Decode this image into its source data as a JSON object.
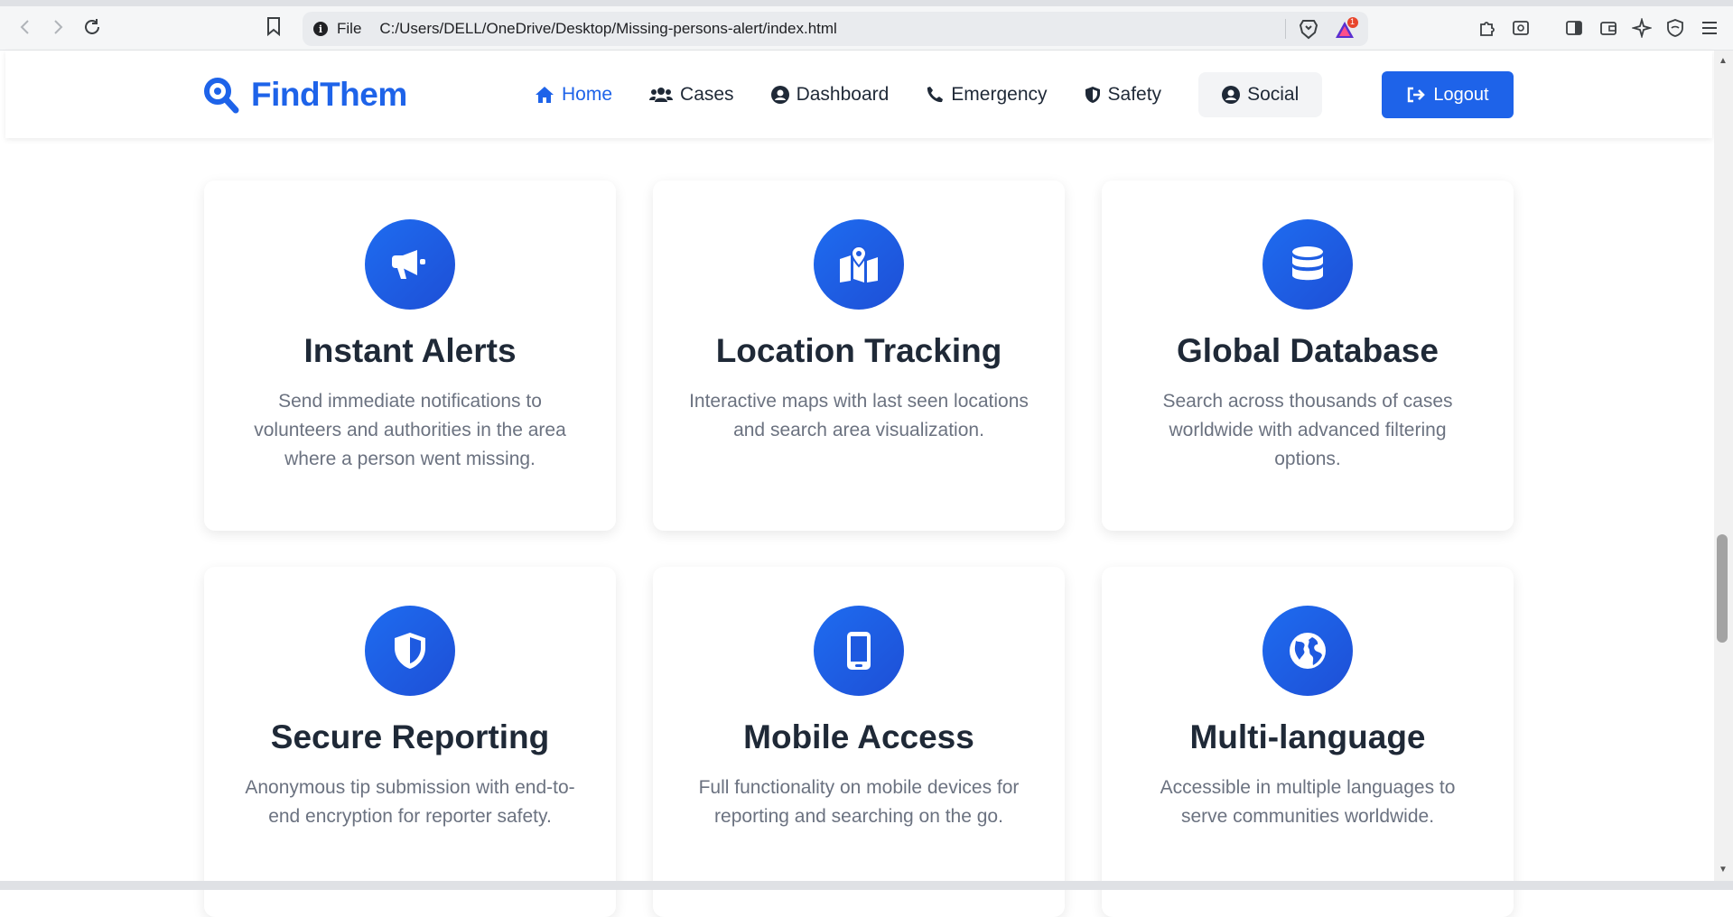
{
  "browser": {
    "url_scheme": "File",
    "url": "C:/Users/DELL/OneDrive/Desktop/Missing-persons-alert/index.html",
    "notification_count": "1"
  },
  "header": {
    "logo_text": "FindThem",
    "nav": [
      {
        "label": "Home",
        "icon": "home-icon",
        "active": true
      },
      {
        "label": "Cases",
        "icon": "users-icon"
      },
      {
        "label": "Dashboard",
        "icon": "user-circle-icon"
      },
      {
        "label": "Emergency",
        "icon": "phone-icon"
      },
      {
        "label": "Safety",
        "icon": "shield-icon"
      },
      {
        "label": "Social",
        "icon": "user-circle-icon"
      }
    ],
    "logout_label": "Logout"
  },
  "features": [
    {
      "title": "Instant Alerts",
      "description": "Send immediate notifications to volunteers and authorities in the area where a person went missing.",
      "icon": "megaphone-icon"
    },
    {
      "title": "Location Tracking",
      "description": "Interactive maps with last seen locations and search area visualization.",
      "icon": "map-pin-icon"
    },
    {
      "title": "Global Database",
      "description": "Search across thousands of cases worldwide with advanced filtering options.",
      "icon": "database-icon"
    },
    {
      "title": "Secure Reporting",
      "description": "Anonymous tip submission with end-to-end encryption for reporter safety.",
      "icon": "shield-icon"
    },
    {
      "title": "Mobile Access",
      "description": "Full functionality on mobile devices for reporting and searching on the go.",
      "icon": "mobile-icon"
    },
    {
      "title": "Multi-language",
      "description": "Accessible in multiple languages to serve communities worldwide.",
      "icon": "globe-icon"
    }
  ],
  "colors": {
    "primary": "#1e63e9",
    "text_dark": "#1f2937",
    "text_muted": "#6b7280"
  }
}
